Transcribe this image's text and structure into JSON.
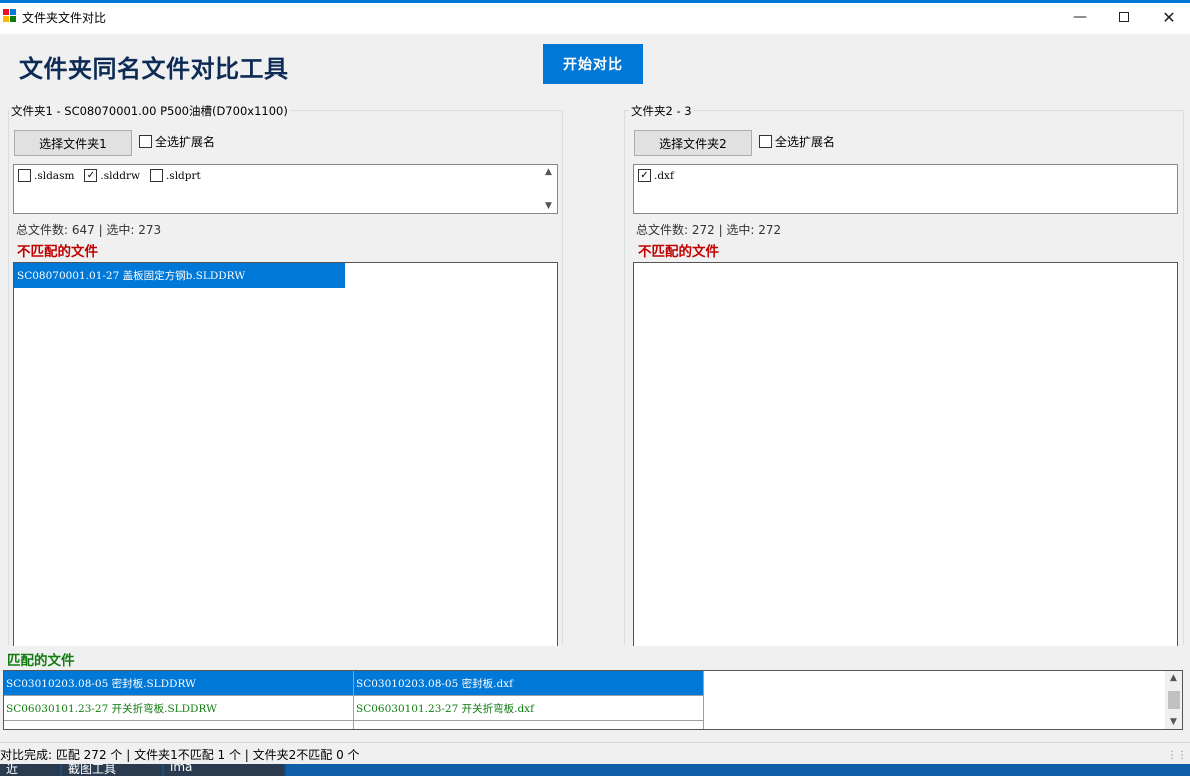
{
  "window": {
    "title": "文件夹文件对比"
  },
  "header": {
    "title": "文件夹同名文件对比工具",
    "compare_button": "开始对比"
  },
  "folder1": {
    "group_title": "文件夹1 - SC08070001.00 P500油槽(D700x1100)",
    "select_button": "选择文件夹1",
    "select_all_label": "全选扩展名",
    "select_all_checked": false,
    "extensions": [
      {
        "label": ".sldasm",
        "checked": false
      },
      {
        "label": ".slddrw",
        "checked": true
      },
      {
        "label": ".sldprt",
        "checked": false
      }
    ],
    "count_text": "总文件数: 647 | 选中: 273",
    "unmatched_heading": "不匹配的文件",
    "unmatched_files": [
      "SC08070001.01-27 盖板固定方钢b.SLDDRW"
    ]
  },
  "folder2": {
    "group_title": "文件夹2 - 3",
    "select_button": "选择文件夹2",
    "select_all_label": "全选扩展名",
    "select_all_checked": false,
    "extensions": [
      {
        "label": ".dxf",
        "checked": true
      }
    ],
    "count_text": "总文件数: 272 | 选中: 272",
    "unmatched_heading": "不匹配的文件",
    "unmatched_files": []
  },
  "matched": {
    "heading": "匹配的文件",
    "rows": [
      {
        "left": "SC03010203.08-05 密封板.SLDDRW",
        "right": "SC03010203.08-05 密封板.dxf",
        "selected": true
      },
      {
        "left": "SC06030101.23-27 开关折弯板.SLDDRW",
        "right": "SC06030101.23-27 开关折弯板.dxf",
        "selected": false
      }
    ]
  },
  "status": {
    "text": "对比完成: 匹配 272 个 | 文件夹1不匹配 1 个 | 文件夹2不匹配 0 个"
  },
  "taskbar": {
    "items": [
      "近",
      "截图工具",
      "ima"
    ]
  },
  "colors": {
    "accent": "#0078d7",
    "title": "#0d2b55",
    "unmatched": "#c00000",
    "matched": "#107c10"
  }
}
